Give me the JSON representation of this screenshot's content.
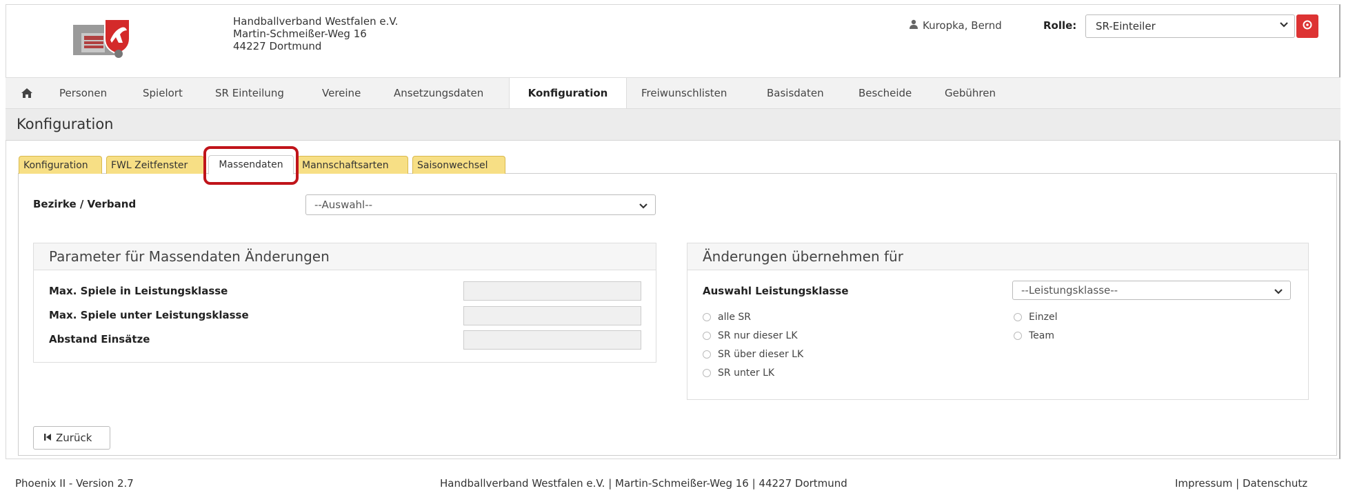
{
  "header": {
    "org_name": "Handballverband Westfalen e.V.",
    "street": "Martin-Schmeißer-Weg 16",
    "city": "44227 Dortmund",
    "user_name": "Kuropka, Bernd",
    "rolle_label": "Rolle:",
    "rolle_value": "SR-Einteiler"
  },
  "nav": {
    "items": [
      "Personen",
      "Spielort",
      "SR Einteilung",
      "Vereine",
      "Ansetzungsdaten",
      "Konfiguration",
      "Freiwunschlisten",
      "Basisdaten",
      "Bescheide",
      "Gebühren"
    ],
    "active": "Konfiguration"
  },
  "page": {
    "title": "Konfiguration"
  },
  "tabs": [
    "Konfiguration",
    "FWL Zeitfenster",
    "Massendaten",
    "Mannschaftsarten",
    "Saisonwechsel"
  ],
  "active_tab": "Massendaten",
  "form": {
    "bezirke_label": "Bezirke / Verband",
    "bezirke_value": "--Auswahl--"
  },
  "param_panel": {
    "title": "Parameter für Massendaten Änderungen",
    "fields": [
      "Max. Spiele in Leistungsklasse",
      "Max. Spiele unter Leistungsklasse",
      "Abstand Einsätze"
    ]
  },
  "apply_panel": {
    "title": "Änderungen übernehmen für",
    "lk_label": "Auswahl Leistungsklasse",
    "lk_value": "--Leistungsklasse--",
    "radios_left": [
      "alle SR",
      "SR nur dieser LK",
      "SR über dieser LK",
      "SR unter LK"
    ],
    "radios_right": [
      "Einzel",
      "Team"
    ]
  },
  "back_button": "Zurück",
  "footer": {
    "version": "Phoenix II - Version 2.7",
    "center": "Handballverband Westfalen e.V. | Martin-Schmeißer-Weg 16 | 44227 Dortmund",
    "links": "Impressum | Datenschutz"
  },
  "colors": {
    "accent_red": "#dd3333",
    "tab_yellow": "#f7df85",
    "highlight_red": "#c0141a"
  }
}
